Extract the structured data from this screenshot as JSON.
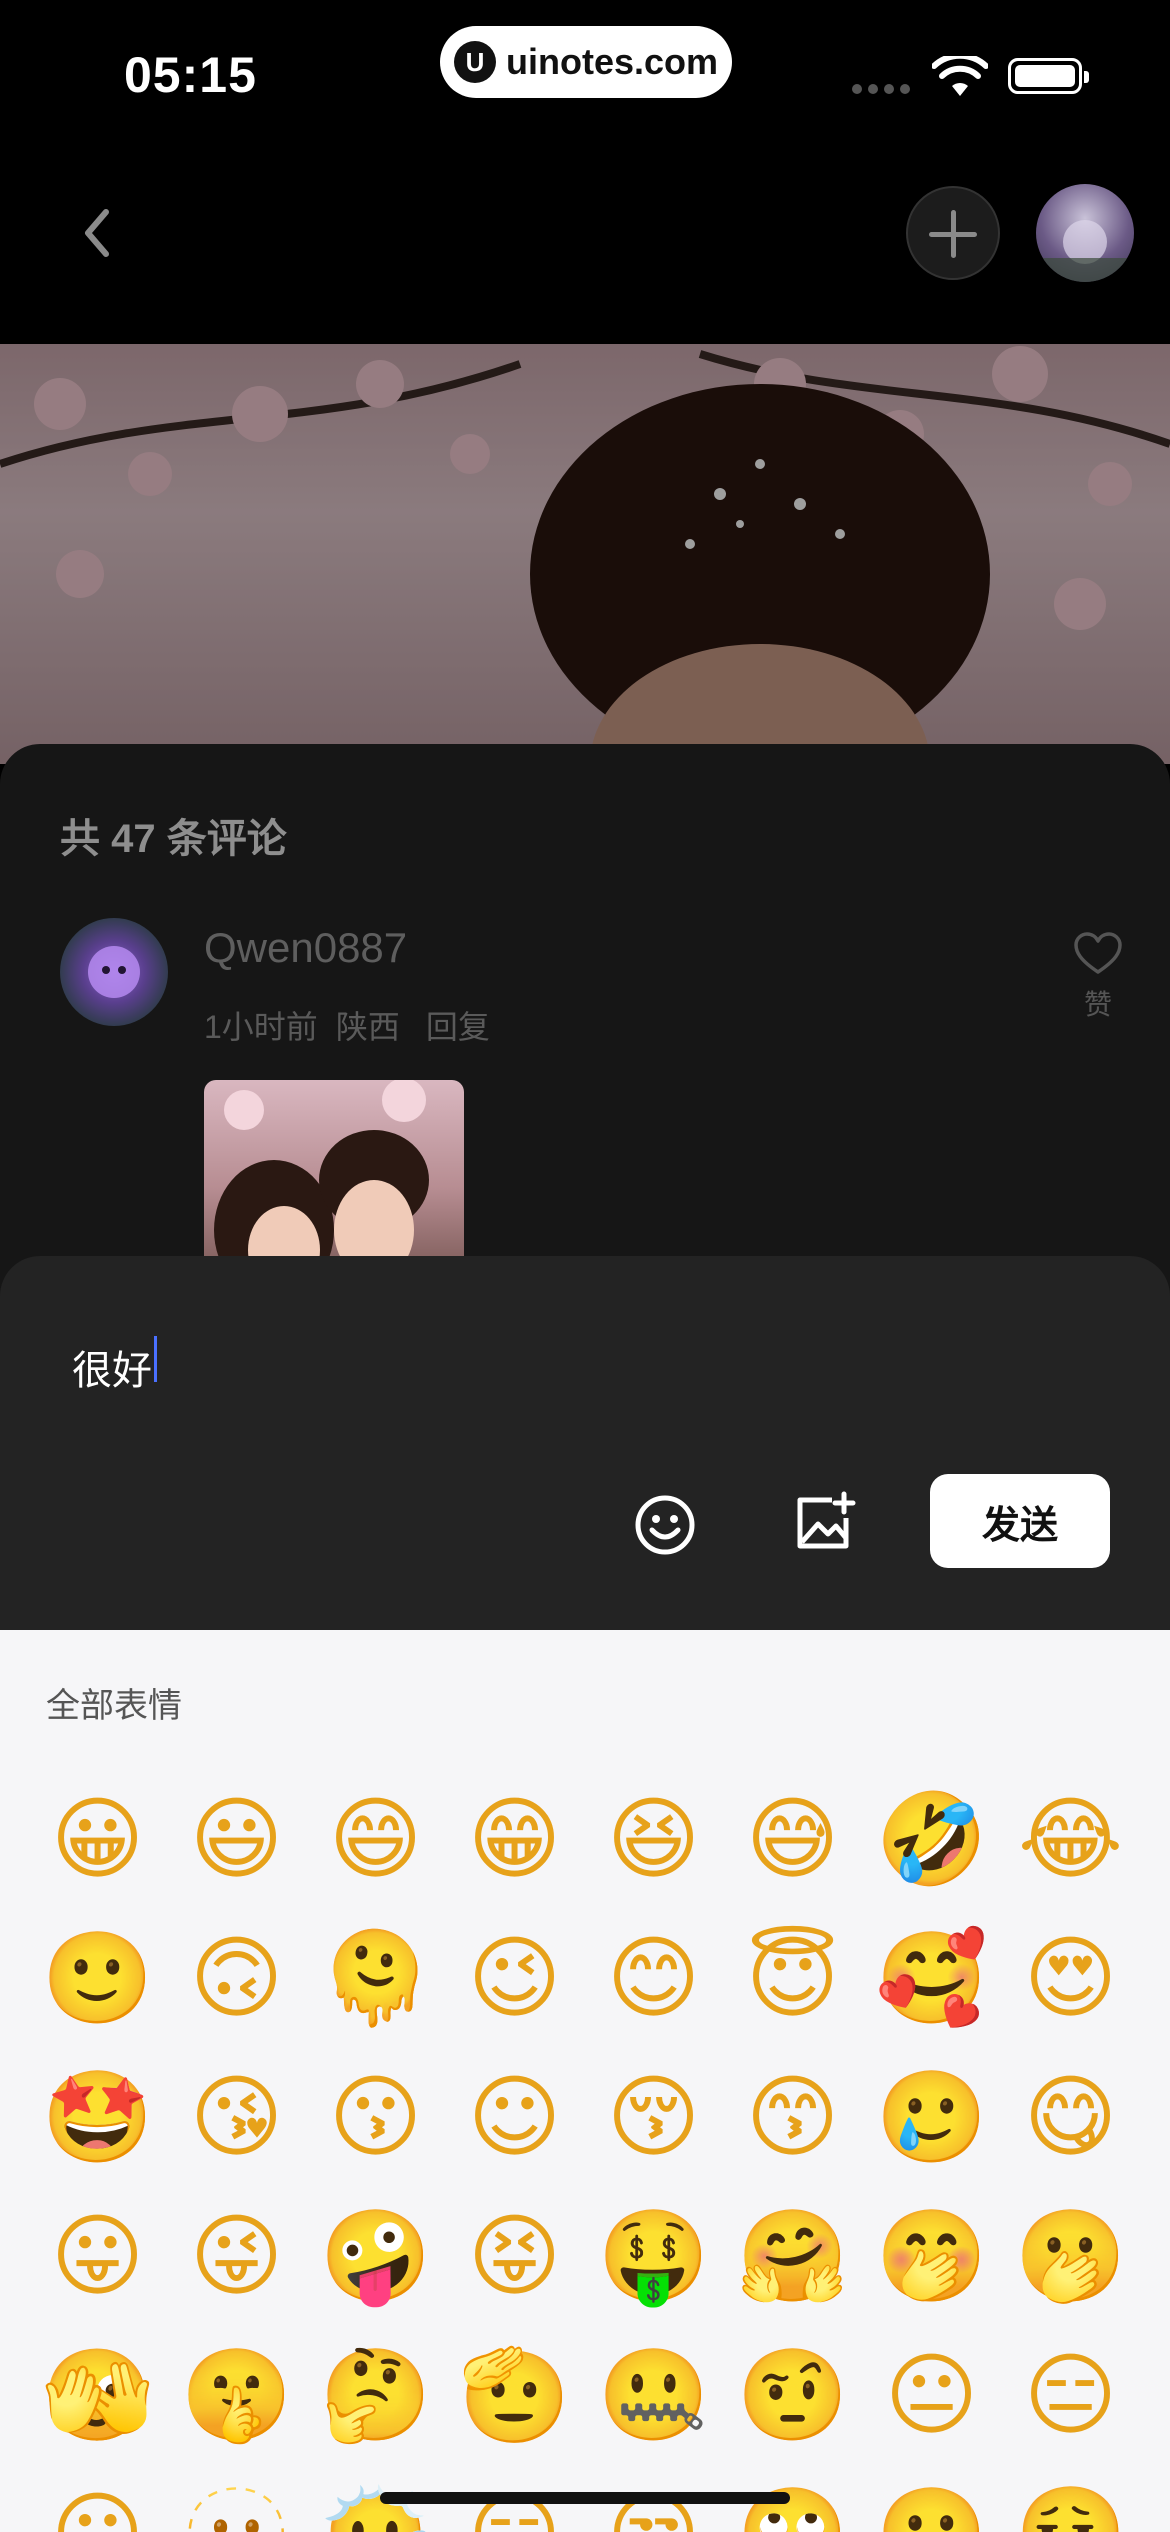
{
  "status_bar": {
    "time": "05:15",
    "site_logo_letter": "U",
    "site_name": "uinotes.com"
  },
  "comments": {
    "count_label": "共 47 条评论",
    "items": [
      {
        "username": "Qwen0887",
        "time_ago": "1小时前",
        "location": "陕西",
        "reply_label": "回复",
        "like_label": "赞"
      }
    ]
  },
  "composer": {
    "text": "很好",
    "send_label": "发送"
  },
  "emoji_panel": {
    "heading": "全部表情",
    "emojis": [
      "😀",
      "😃",
      "😄",
      "😁",
      "😆",
      "😅",
      "🤣",
      "😂",
      "🙂",
      "🙃",
      "🫠",
      "😉",
      "😊",
      "😇",
      "🥰",
      "😍",
      "🤩",
      "😘",
      "😗",
      "☺",
      "😚",
      "😙",
      "🥲",
      "😋",
      "😛",
      "😜",
      "🤪",
      "😝",
      "🤑",
      "🤗",
      "🤭",
      "🫢",
      "🫣",
      "🤫",
      "🤔",
      "🫡",
      "🤐",
      "🤨",
      "😐",
      "😑",
      "😶",
      "🫥",
      "😶‍🌫️",
      "😏",
      "😒",
      "🙄",
      "😬",
      "😮‍💨"
    ]
  },
  "colors": {
    "accent_caret": "#4a70ff",
    "panel_bg": "#232323",
    "emoji_bg": "#f6f6f8"
  }
}
